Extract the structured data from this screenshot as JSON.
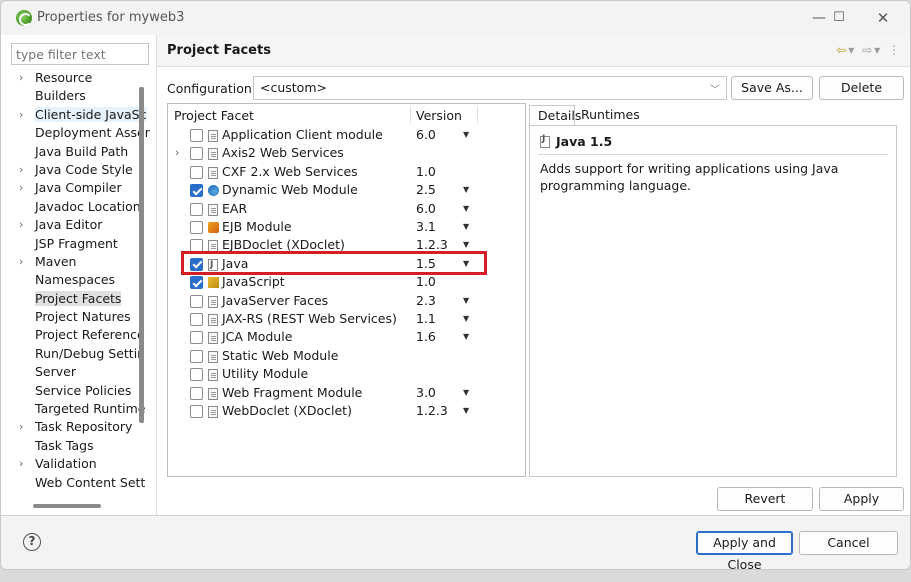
{
  "window": {
    "title": "Properties for myweb3"
  },
  "sidebar": {
    "filter_placeholder": "type filter text",
    "items": [
      {
        "label": "Resource",
        "expandable": true
      },
      {
        "label": "Builders",
        "expandable": false
      },
      {
        "label": "Client-side JavaSc",
        "expandable": true
      },
      {
        "label": "Deployment Asser",
        "expandable": false
      },
      {
        "label": "Java Build Path",
        "expandable": false
      },
      {
        "label": "Java Code Style",
        "expandable": true
      },
      {
        "label": "Java Compiler",
        "expandable": true
      },
      {
        "label": "Javadoc Location",
        "expandable": false
      },
      {
        "label": "Java Editor",
        "expandable": true
      },
      {
        "label": "JSP Fragment",
        "expandable": false
      },
      {
        "label": "Maven",
        "expandable": true
      },
      {
        "label": "Namespaces",
        "expandable": false
      },
      {
        "label": "Project Facets",
        "expandable": false
      },
      {
        "label": "Project Natures",
        "expandable": false
      },
      {
        "label": "Project Reference",
        "expandable": false
      },
      {
        "label": "Run/Debug Settir",
        "expandable": false
      },
      {
        "label": "Server",
        "expandable": false
      },
      {
        "label": "Service Policies",
        "expandable": false
      },
      {
        "label": "Targeted Runtime",
        "expandable": false
      },
      {
        "label": "Task Repository",
        "expandable": true
      },
      {
        "label": "Task Tags",
        "expandable": false
      },
      {
        "label": "Validation",
        "expandable": true
      },
      {
        "label": "Web Content Sett",
        "expandable": false
      }
    ],
    "selected": "Project Facets"
  },
  "page": {
    "title": "Project Facets",
    "configuration_label": "Configuration:",
    "configuration_value": "<custom>",
    "save_as_label": "Save As...",
    "delete_label": "Delete"
  },
  "facets": {
    "col_facet": "Project Facet",
    "col_version": "Version",
    "rows": [
      {
        "name": "Application Client module",
        "version": "6.0",
        "checked": false,
        "dropdown": true,
        "icon": "doc",
        "twisty": false
      },
      {
        "name": "Axis2 Web Services",
        "version": "",
        "checked": false,
        "dropdown": false,
        "icon": "doc",
        "twisty": true
      },
      {
        "name": "CXF 2.x Web Services",
        "version": "1.0",
        "checked": false,
        "dropdown": false,
        "icon": "doc",
        "twisty": false
      },
      {
        "name": "Dynamic Web Module",
        "version": "2.5",
        "checked": true,
        "dropdown": true,
        "icon": "web",
        "twisty": false
      },
      {
        "name": "EAR",
        "version": "6.0",
        "checked": false,
        "dropdown": true,
        "icon": "doc",
        "twisty": false
      },
      {
        "name": "EJB Module",
        "version": "3.1",
        "checked": false,
        "dropdown": true,
        "icon": "ejb",
        "twisty": false
      },
      {
        "name": "EJBDoclet (XDoclet)",
        "version": "1.2.3",
        "checked": false,
        "dropdown": true,
        "icon": "doc",
        "twisty": false
      },
      {
        "name": "Java",
        "version": "1.5",
        "checked": true,
        "dropdown": true,
        "icon": "java",
        "twisty": false
      },
      {
        "name": "JavaScript",
        "version": "1.0",
        "checked": true,
        "dropdown": false,
        "icon": "js",
        "twisty": false
      },
      {
        "name": "JavaServer Faces",
        "version": "2.3",
        "checked": false,
        "dropdown": true,
        "icon": "doc",
        "twisty": false
      },
      {
        "name": "JAX-RS (REST Web Services)",
        "version": "1.1",
        "checked": false,
        "dropdown": true,
        "icon": "doc",
        "twisty": false
      },
      {
        "name": "JCA Module",
        "version": "1.6",
        "checked": false,
        "dropdown": true,
        "icon": "doc",
        "twisty": false
      },
      {
        "name": "Static Web Module",
        "version": "",
        "checked": false,
        "dropdown": false,
        "icon": "doc",
        "twisty": false
      },
      {
        "name": "Utility Module",
        "version": "",
        "checked": false,
        "dropdown": false,
        "icon": "doc",
        "twisty": false
      },
      {
        "name": "Web Fragment Module",
        "version": "3.0",
        "checked": false,
        "dropdown": true,
        "icon": "doc",
        "twisty": false
      },
      {
        "name": "WebDoclet (XDoclet)",
        "version": "1.2.3",
        "checked": false,
        "dropdown": true,
        "icon": "doc",
        "twisty": false
      }
    ],
    "highlight_color": "#d21f26"
  },
  "details": {
    "tab_details": "Details",
    "tab_runtimes": "Runtimes",
    "title": "Java 1.5",
    "description": "Adds support for writing applications using Java programming language."
  },
  "buttons": {
    "revert": "Revert",
    "apply": "Apply",
    "apply_close": "Apply and Close",
    "cancel": "Cancel"
  },
  "colors": {
    "accent": "#2a6ec9",
    "highlight": "#d21f26"
  }
}
